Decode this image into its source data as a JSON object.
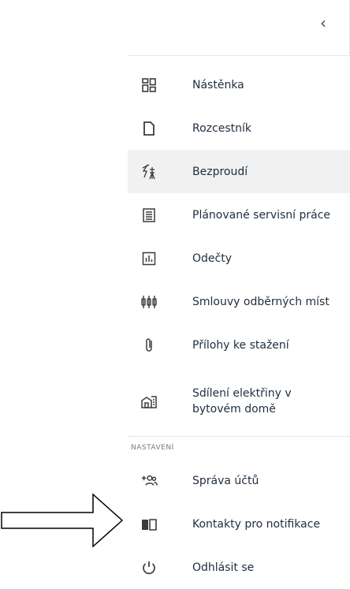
{
  "collapse": {
    "icon": "chevron-left-icon",
    "glyph": "‹"
  },
  "menu": [
    {
      "label": "Nástěnka",
      "icon": "dashboard-grid-icon"
    },
    {
      "label": "Rozcestník",
      "icon": "document-icon"
    },
    {
      "label": "Bezproudí",
      "icon": "power-outage-icon",
      "active": true
    },
    {
      "label": "Plánované servisní práce",
      "icon": "list-icon"
    },
    {
      "label": "Odečty",
      "icon": "meter-readings-icon"
    },
    {
      "label": "Smlouvy odběrných míst",
      "icon": "connection-points-icon"
    },
    {
      "label": "Přílohy ke stažení",
      "icon": "paperclip-icon"
    },
    {
      "label": "Sdílení elektřiny v bytovém domě",
      "icon": "apartment-building-icon"
    }
  ],
  "settings": {
    "title": "NASTAVENÍ",
    "items": [
      {
        "label": "Správa účtů",
        "icon": "add-users-icon"
      },
      {
        "label": "Kontakty pro notifikace",
        "icon": "contacts-book-icon"
      },
      {
        "label": "Odhlásit se",
        "icon": "power-icon"
      }
    ]
  },
  "colors": {
    "active_bg": "#f1f1f1",
    "text": "#1f2d3d",
    "divider": "#e6e6e6"
  }
}
